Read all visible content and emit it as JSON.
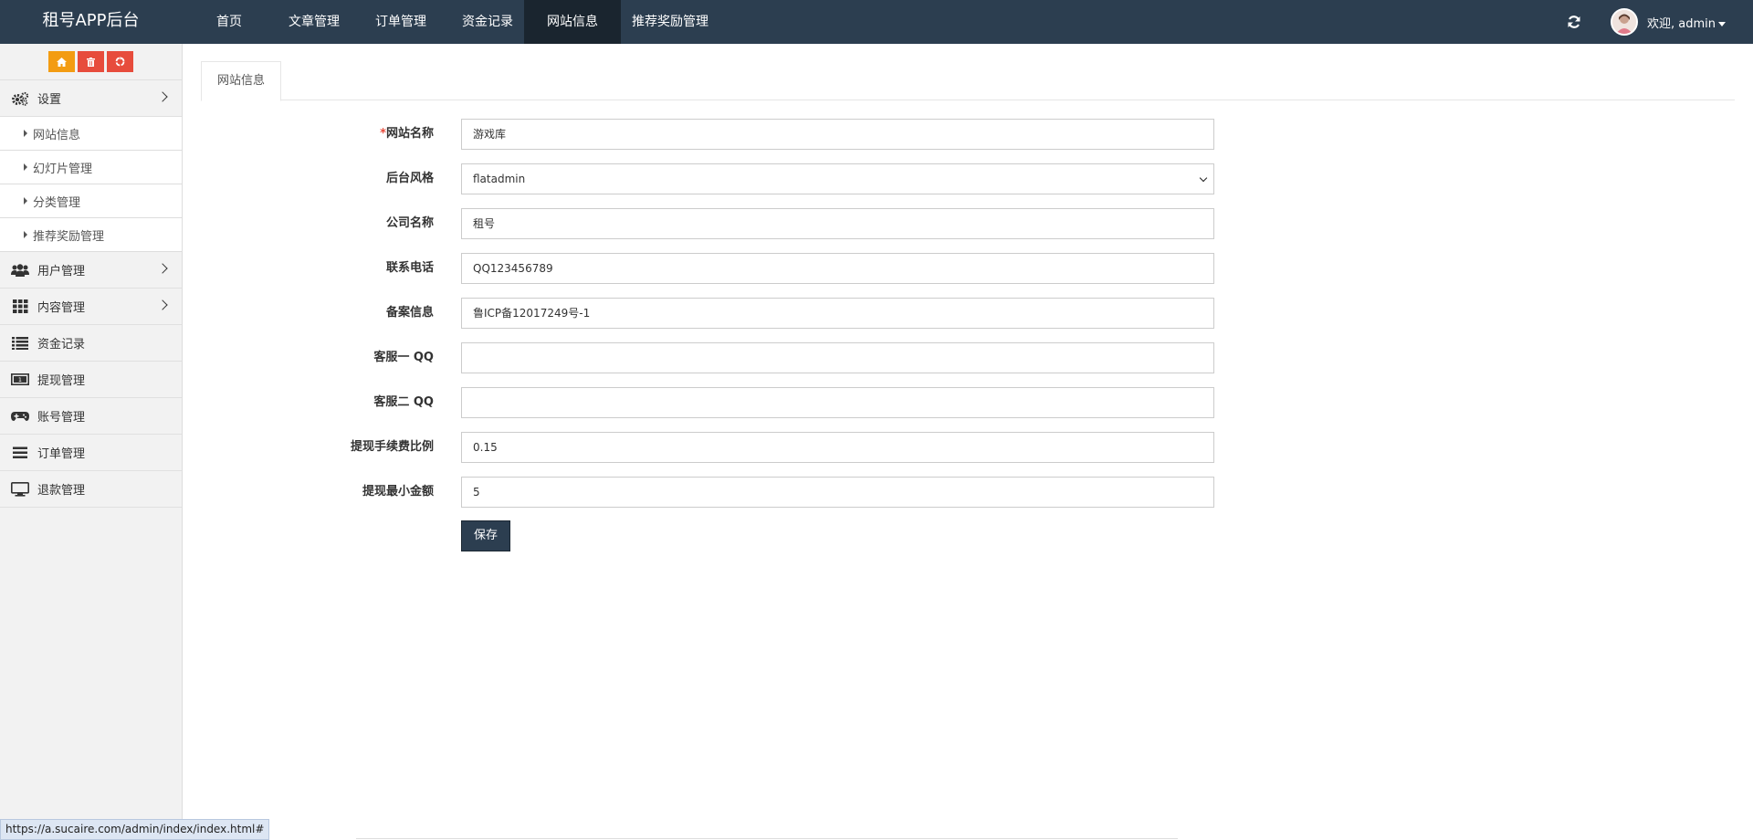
{
  "brand": "租号APP后台",
  "nav": {
    "items": [
      {
        "label": "首页"
      },
      {
        "label": "文章管理"
      },
      {
        "label": "订单管理"
      },
      {
        "label": "资金记录"
      },
      {
        "label": "网站信息"
      },
      {
        "label": "推荐奖励管理"
      }
    ],
    "active": "网站信息"
  },
  "user": {
    "welcome": "欢迎, admin"
  },
  "sidebar": {
    "shortcuts": [
      {
        "icon": "home-icon",
        "color": "#f39c12"
      },
      {
        "icon": "trash-icon",
        "color": "#e74c3c"
      },
      {
        "icon": "recycle-icon",
        "color": "#e74c3c"
      }
    ],
    "settings": {
      "label": "设置",
      "icon": "gears-icon"
    },
    "sub_items": [
      {
        "label": "网站信息"
      },
      {
        "label": "幻灯片管理"
      },
      {
        "label": "分类管理"
      },
      {
        "label": "推荐奖励管理"
      }
    ],
    "items": [
      {
        "label": "用户管理",
        "icon": "users-icon",
        "has_children": true
      },
      {
        "label": "内容管理",
        "icon": "grid-icon",
        "has_children": true
      },
      {
        "label": "资金记录",
        "icon": "list-icon",
        "has_children": false
      },
      {
        "label": "提现管理",
        "icon": "money-icon",
        "has_children": false
      },
      {
        "label": "账号管理",
        "icon": "gamepad-icon",
        "has_children": false
      },
      {
        "label": "订单管理",
        "icon": "bars-icon",
        "has_children": false
      },
      {
        "label": "退款管理",
        "icon": "monitor-icon",
        "has_children": false
      }
    ]
  },
  "tab": {
    "label": "网站信息"
  },
  "form": {
    "site_name": {
      "label": "网站名称",
      "required_mark": "*",
      "value": "游戏库"
    },
    "admin_style": {
      "label": "后台风格",
      "value": "flatadmin"
    },
    "company_name": {
      "label": "公司名称",
      "value": "租号"
    },
    "phone": {
      "label": "联系电话",
      "value": "QQ123456789"
    },
    "icp": {
      "label": "备案信息",
      "value": "鲁ICP备12017249号-1"
    },
    "service_qq1": {
      "label": "客服一 QQ",
      "value": ""
    },
    "service_qq2": {
      "label": "客服二 QQ",
      "value": ""
    },
    "withdraw_fee": {
      "label": "提现手续费比例",
      "value": "0.15"
    },
    "withdraw_min": {
      "label": "提现最小金额",
      "value": "5"
    },
    "save_label": "保存"
  },
  "status_url": "https://a.sucaire.com/admin/index/index.html#",
  "colors": {
    "topbar": "#2c3e50",
    "accent_orange": "#f39c12",
    "accent_red": "#e74c3c",
    "required": "#e74c3c"
  }
}
